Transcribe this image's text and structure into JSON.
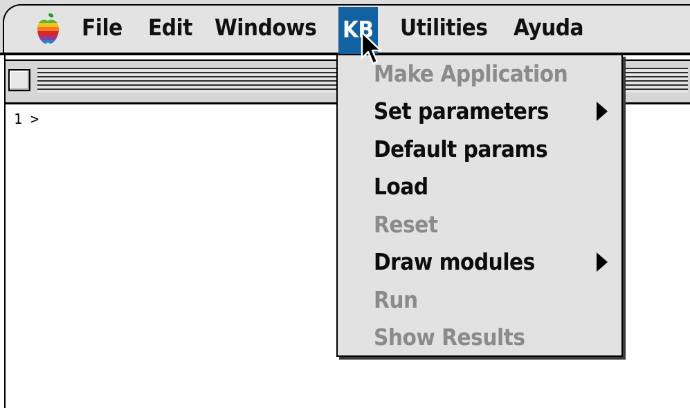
{
  "menubar": {
    "apple_icon": "apple-menu-icon",
    "items": [
      {
        "label": "File"
      },
      {
        "label": "Edit"
      },
      {
        "label": "Windows"
      },
      {
        "label": "KB",
        "selected": true
      },
      {
        "label": "Utilities"
      },
      {
        "label": "Ayuda"
      }
    ]
  },
  "window": {
    "prompt": "1 >"
  },
  "kb_menu": {
    "items": [
      {
        "label": "Make Application",
        "enabled": false,
        "submenu": false
      },
      {
        "label": "Set parameters",
        "enabled": true,
        "submenu": true
      },
      {
        "label": "Default params",
        "enabled": true,
        "submenu": false
      },
      {
        "label": "Load",
        "enabled": true,
        "submenu": false
      },
      {
        "label": "Reset",
        "enabled": false,
        "submenu": false
      },
      {
        "label": "Draw modules",
        "enabled": true,
        "submenu": true
      },
      {
        "label": "Run",
        "enabled": false,
        "submenu": false
      },
      {
        "label": "Show Results",
        "enabled": false,
        "submenu": false
      }
    ]
  },
  "colors": {
    "menu_highlight": "#1261a0",
    "disabled_text": "#8b8b8b",
    "menu_background": "#e2e2e2"
  }
}
